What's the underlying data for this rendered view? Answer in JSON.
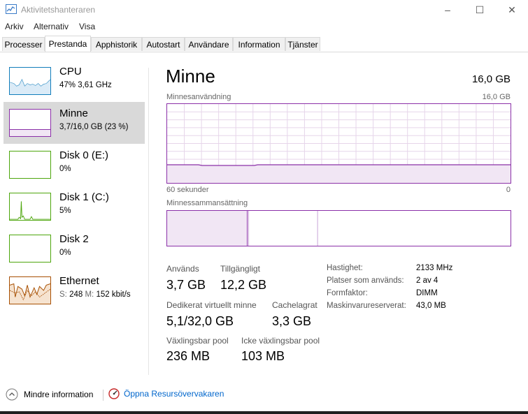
{
  "window": {
    "title": "Aktivitetshanteraren",
    "icon": "task-manager-icon",
    "controls": {
      "minimize": "–",
      "maximize": "☐",
      "close": "✕"
    }
  },
  "menu": [
    "Arkiv",
    "Alternativ",
    "Visa"
  ],
  "tabs": [
    "Processer",
    "Prestanda",
    "Apphistorik",
    "Autostart",
    "Användare",
    "Information",
    "Tjänster"
  ],
  "active_tab": "Prestanda",
  "sidebar": [
    {
      "title": "CPU",
      "sub": "47% 3,61 GHz",
      "color": "#117dbb"
    },
    {
      "title": "Minne",
      "sub": "3,7/16,0 GB (23 %)",
      "color": "#8b30a8",
      "selected": true
    },
    {
      "title": "Disk 0 (E:)",
      "sub": "0%",
      "color": "#4da60c"
    },
    {
      "title": "Disk 1 (C:)",
      "sub": "5%",
      "color": "#4da60c"
    },
    {
      "title": "Disk 2",
      "sub": "0%",
      "color": "#4da60c"
    },
    {
      "title": "Ethernet",
      "sub_s_label": "S:",
      "sub_s_val": "248",
      "sub_m_label": "M:",
      "sub_m_val": "152 kbit/s",
      "color": "#a74f01"
    }
  ],
  "main": {
    "title": "Minne",
    "total": "16,0 GB",
    "usage_label": "Minnesanvändning",
    "usage_max": "16,0 GB",
    "time_label": "60 sekunder",
    "time_zero": "0",
    "composition_label": "Minnessammansättning",
    "usage_level_fraction": 0.23,
    "stats": {
      "in_use_label": "Används",
      "in_use": "3,7 GB",
      "available_label": "Tillgängligt",
      "available": "12,2 GB",
      "committed_label": "Dedikerat virtuellt minne",
      "committed": "5,1/32,0 GB",
      "cached_label": "Cachelagrat",
      "cached": "3,3 GB",
      "paged_label": "Växlingsbar pool",
      "paged": "236 MB",
      "nonpaged_label": "Icke växlingsbar pool",
      "nonpaged": "103 MB"
    },
    "details": [
      {
        "label": "Hastighet:",
        "value": "2133 MHz"
      },
      {
        "label": "Platser som används:",
        "value": "2 av 4"
      },
      {
        "label": "Formfaktor:",
        "value": "DIMM"
      },
      {
        "label": "Maskinvarureserverat:",
        "value": "43,0 MB"
      }
    ]
  },
  "footer": {
    "less_info": "Mindre information",
    "open_monitor": "Öppna Resursövervakaren"
  },
  "colors": {
    "memory": "#8b30a8",
    "cpu": "#117dbb",
    "disk": "#4da60c",
    "ethernet": "#a74f01",
    "link": "#0066cc"
  }
}
